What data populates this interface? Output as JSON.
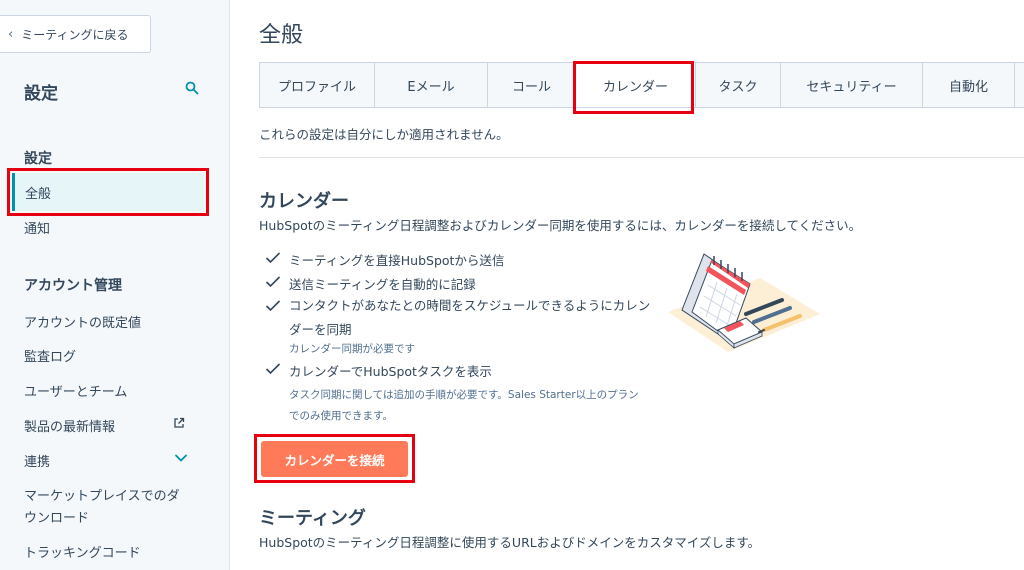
{
  "sidebar": {
    "back_label": "ミーティングに戻る",
    "title": "設定",
    "section_settings": "設定",
    "item_general": "全般",
    "item_notifications": "通知",
    "section_account": "アカウント管理",
    "item_account_defaults": "アカウントの既定値",
    "item_audit_logs": "監査ログ",
    "item_users_teams": "ユーザーとチーム",
    "item_product_updates": "製品の最新情報",
    "item_integrations": "連携",
    "item_marketplace_line1": "マーケットプレイスでのダ",
    "item_marketplace_line2": "ウンロード",
    "item_tracking_code": "トラッキングコード"
  },
  "main": {
    "title": "全般",
    "tabs": [
      "プロファイル",
      "Eメール",
      "コール",
      "カレンダー",
      "タスク",
      "セキュリティー",
      "自動化"
    ],
    "active_tab": "カレンダー",
    "notice": "これらの設定は自分にしか適用されません。",
    "calendar": {
      "heading": "カレンダー",
      "description": "HubSpotのミーティング日程調整およびカレンダー同期を使用するには、カレンダーを接続してください。",
      "features": [
        "ミーティングを直接HubSpotから送信",
        "送信ミーティングを自動的に記録",
        "コンタクトがあなたとの時間をスケジュールできるようにカレン",
        "カレンダーでHubSpotタスクを表示"
      ],
      "feature3_line2": "ダーを同期",
      "feature3_note": "カレンダー同期が必要です",
      "feature4_note_line1": "タスク同期に関しては追加の手順が必要です。Sales Starter以上のプラン",
      "feature4_note_line2": "でのみ使用できます。",
      "connect_button": "カレンダーを接続"
    },
    "meetings": {
      "heading": "ミーティング",
      "description": "HubSpotのミーティング日程調整に使用するURLおよびドメインをカスタマイズします。"
    }
  },
  "colors": {
    "accent_teal": "#0091ae",
    "cta_orange": "#ff7a59",
    "highlight_red": "#e60012",
    "text": "#33475b"
  }
}
